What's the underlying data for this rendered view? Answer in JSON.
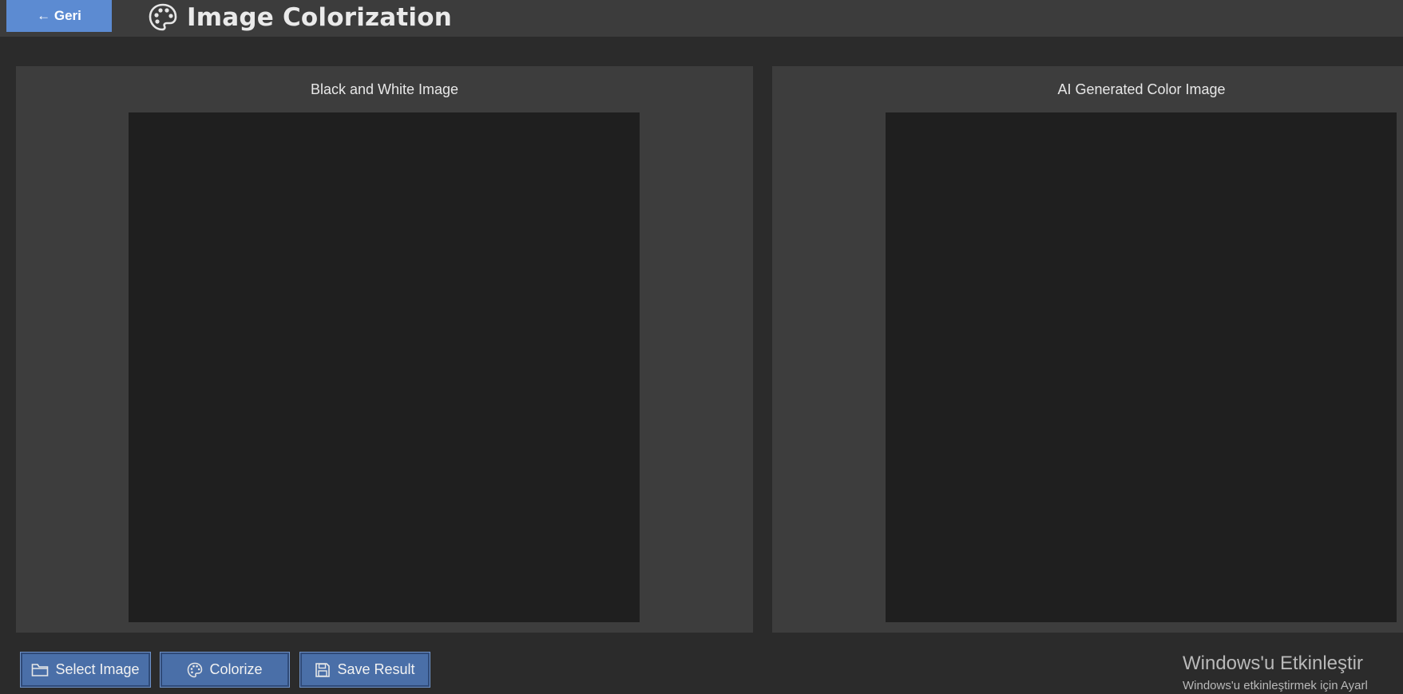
{
  "header": {
    "back_label": "← Geri",
    "title": "Image Colorization",
    "title_icon": "palette-icon"
  },
  "panels": {
    "left": {
      "label": "Black and White Image"
    },
    "right": {
      "label": "AI Generated Color Image"
    }
  },
  "buttons": {
    "select": {
      "label": "Select Image",
      "icon": "folder-icon"
    },
    "colorize": {
      "label": "Colorize",
      "icon": "palette-icon"
    },
    "save": {
      "label": "Save Result",
      "icon": "floppy-disk-icon"
    }
  },
  "watermark": {
    "title": "Windows'u Etkinleştir",
    "subtitle": "Windows'u etkinleştirmek için Ayarl"
  },
  "colors": {
    "background": "#2b2b2b",
    "header": "#3c3c3c",
    "panel": "#3d3d3d",
    "image_area": "#1f1f1f",
    "accent": "#5c8bd2",
    "button": "#4a6fa8"
  }
}
